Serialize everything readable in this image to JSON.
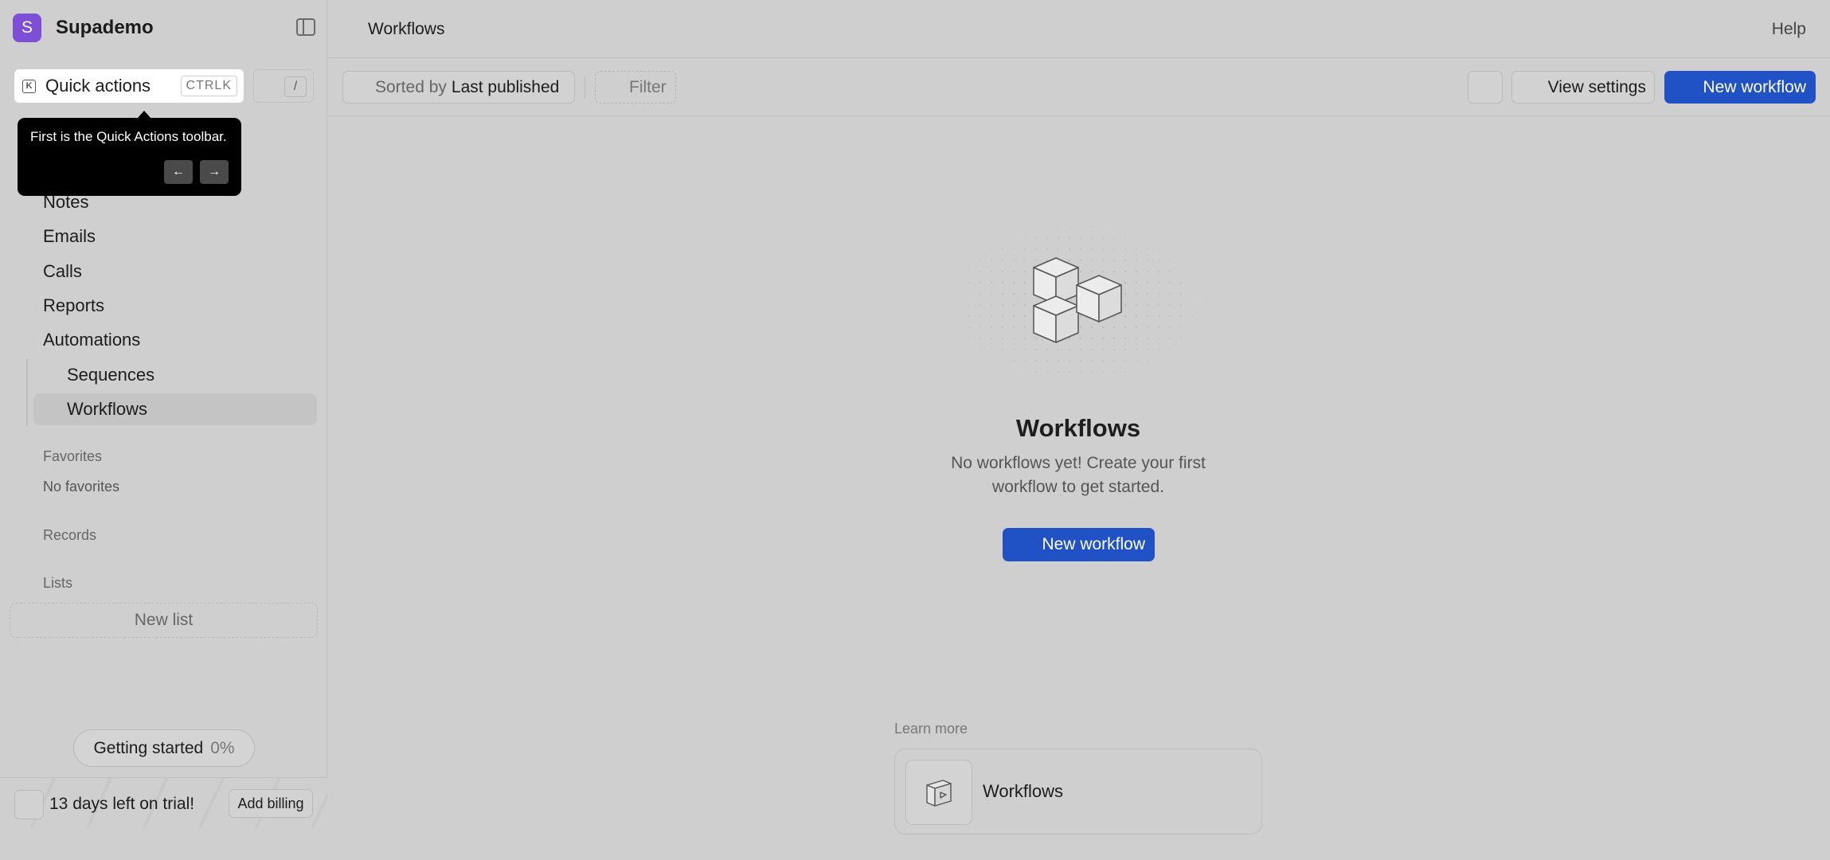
{
  "workspace": {
    "initial": "S",
    "name": "Supademo"
  },
  "quick_actions": {
    "label": "Quick actions",
    "shortcut": "CTRLK",
    "slash": "/"
  },
  "tooltip": {
    "text": "First is the Quick Actions toolbar.",
    "prev": "←",
    "next": "→"
  },
  "nav": {
    "notes": "Notes",
    "emails": "Emails",
    "calls": "Calls",
    "reports": "Reports",
    "automations": "Automations",
    "sequences": "Sequences",
    "workflows": "Workflows"
  },
  "sections": {
    "favorites": "Favorites",
    "no_favorites": "No favorites",
    "records": "Records",
    "lists": "Lists",
    "new_list": "New list"
  },
  "getting_started": {
    "label": "Getting started",
    "percent": "0%"
  },
  "trial": {
    "text": "13 days left on trial!",
    "billing": "Add billing"
  },
  "header": {
    "title": "Workflows",
    "help": "Help"
  },
  "toolbar": {
    "sort_prefix": "Sorted by",
    "sort_value": "Last published",
    "filter": "Filter",
    "view_settings": "View settings",
    "new_workflow": "New workflow"
  },
  "empty_state": {
    "title": "Workflows",
    "description": "No workflows yet! Create your first workflow to get started.",
    "button": "New workflow"
  },
  "learn_more": {
    "heading": "Learn more",
    "card_title": "Workflows"
  },
  "colors": {
    "accent": "#2152c5",
    "workspace": "#7c4fd6",
    "background": "#cfcfcf"
  }
}
